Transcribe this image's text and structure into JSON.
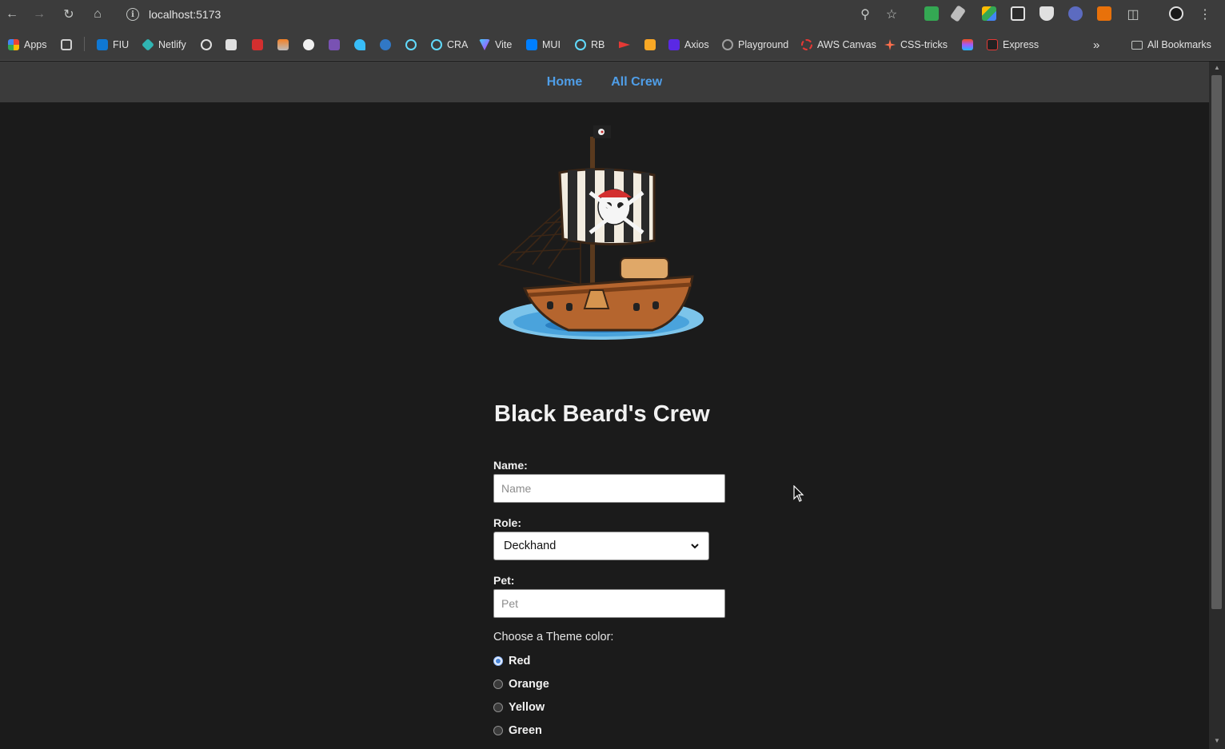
{
  "browser": {
    "url": "localhost:5173",
    "bookmarks": [
      "Apps",
      "FIU",
      "Netlify",
      "CRA",
      "Vite",
      "MUI",
      "RB",
      "Axios",
      "Playground",
      "AWS Canvas",
      "CSS-tricks",
      "Express"
    ],
    "all_bookmarks_label": "All Bookmarks"
  },
  "nav": {
    "home": "Home",
    "all_crew": "All Crew"
  },
  "page": {
    "title": "Black Beard's Crew"
  },
  "form": {
    "name_label": "Name:",
    "name_placeholder": "Name",
    "role_label": "Role:",
    "role_value": "Deckhand",
    "pet_label": "Pet:",
    "pet_placeholder": "Pet",
    "theme_prompt": "Choose a Theme color:",
    "theme_options": [
      "Red",
      "Orange",
      "Yellow",
      "Green"
    ],
    "theme_selected": "Red"
  },
  "colors": {
    "nav_link": "#4f9ee8",
    "background": "#1b1b1b",
    "navbar": "#3b3b3b"
  }
}
